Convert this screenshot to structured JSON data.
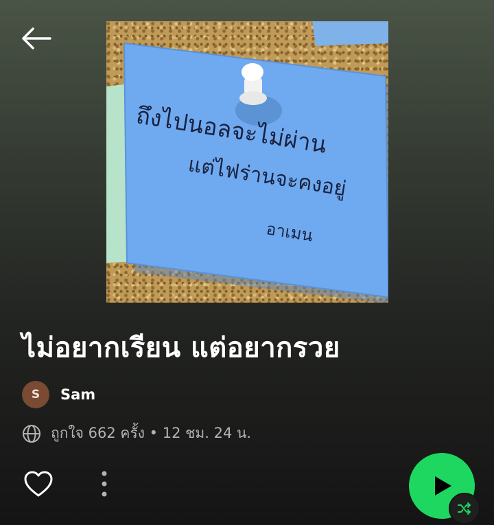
{
  "icons": {
    "back": "arrow-left-icon",
    "globe": "globe-icon",
    "like": "heart-outline-icon",
    "more": "more-vertical-icon",
    "play": "play-icon",
    "shuffle": "shuffle-icon"
  },
  "colors": {
    "accent": "#1ed760",
    "avatar_bg": "#7a4a33",
    "muted_text": "#b3b3b3"
  },
  "cover": {
    "note_line1": "ถึงไปนอลจะไม่ผ่าน",
    "note_line2": "แต่ไฟร่านจะคงอยู่",
    "note_signature": "อาเมน"
  },
  "playlist": {
    "title": "ไม่อยากเรียน แต่อยากรวย",
    "owner_initial": "S",
    "owner_name": "Sam",
    "meta": "ถูกใจ 662 ครั้ง • 12 ชม. 24 น."
  }
}
